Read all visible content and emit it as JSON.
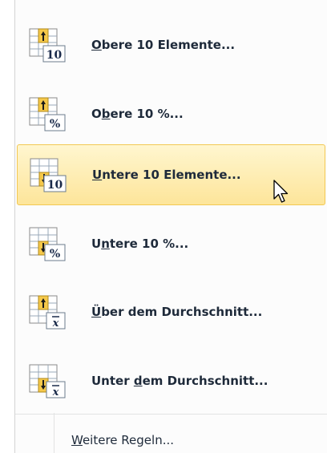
{
  "menu": {
    "items": [
      {
        "icon": "top-10-items-icon",
        "pre": "",
        "acc": "O",
        "post": "bere 10 Elemente...",
        "hover": false
      },
      {
        "icon": "top-10-percent-icon",
        "pre": "O",
        "acc": "b",
        "post": "ere 10 %...",
        "hover": false
      },
      {
        "icon": "bottom-10-items-icon",
        "pre": "",
        "acc": "U",
        "post": "ntere 10 Elemente...",
        "hover": true
      },
      {
        "icon": "bottom-10-percent-icon",
        "pre": "U",
        "acc": "n",
        "post": "tere 10 %...",
        "hover": false
      },
      {
        "icon": "above-average-icon",
        "pre": "",
        "acc": "Ü",
        "post": "ber dem Durchschnitt...",
        "hover": false
      },
      {
        "icon": "below-average-icon",
        "pre": "Unter ",
        "acc": "d",
        "post": "em Durchschnitt...",
        "hover": false
      }
    ],
    "more": {
      "acc": "W",
      "post": "eitere Regeln..."
    }
  },
  "colors": {
    "hover_bg": "#fde59a",
    "hover_border": "#f3c852",
    "text": "#1e2a3a"
  }
}
